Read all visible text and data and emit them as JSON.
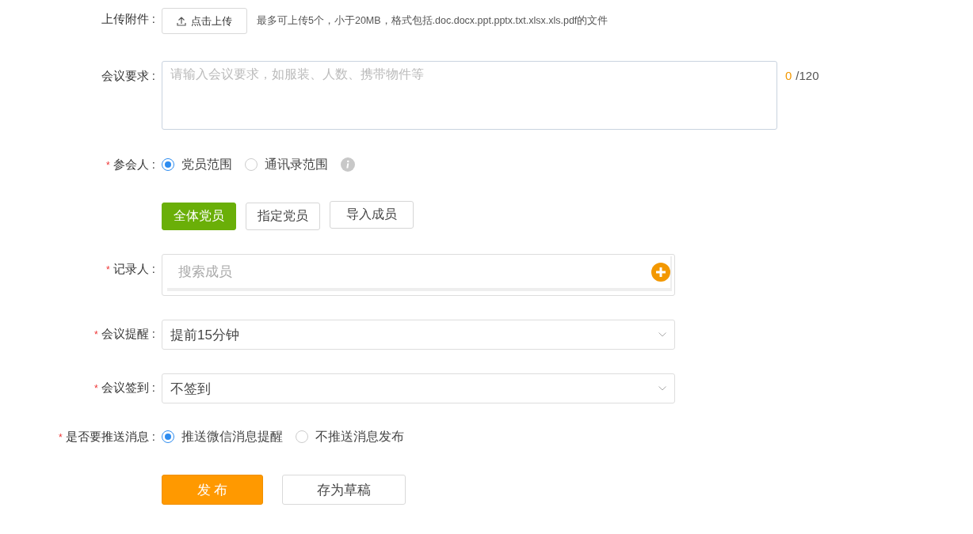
{
  "fields": [
    {
      "kind": "upload",
      "label": "上传附件 :",
      "button": "点击上传",
      "hint": "最多可上传5个，小于20MB，格式包括.doc.docx.ppt.pptx.txt.xlsx.xls.pdf的文件"
    },
    {
      "kind": "textarea",
      "label": "会议要求 :",
      "placeholder": "请输入会议要求，如服装、人数、携带物件等",
      "count": "0",
      "limit": "/120"
    },
    {
      "kind": "radio",
      "label": "参会人 :",
      "marker": "*",
      "info": true,
      "options": [
        {
          "label": "党员范围",
          "selected": true
        },
        {
          "label": "通讯录范围",
          "selected": false
        }
      ]
    },
    {
      "kind": "buttons",
      "options": [
        {
          "label": "全体党员",
          "selected": true
        },
        {
          "label": "指定党员",
          "selected": false
        },
        {
          "label": "导入成员",
          "selected": false
        }
      ]
    },
    {
      "kind": "search",
      "label": "记录人 :",
      "marker": "*",
      "placeholder": "搜索成员"
    },
    {
      "kind": "select",
      "label": "会议提醒 :",
      "marker": "*",
      "value": "提前15分钟"
    },
    {
      "kind": "select",
      "label": "会议签到 :",
      "marker": "*",
      "value": "不签到"
    },
    {
      "kind": "radio",
      "label": "是否要推送消息 :",
      "marker": "*",
      "info": false,
      "options": [
        {
          "label": "推送微信消息提醒",
          "selected": true
        },
        {
          "label": "不推送消息发布",
          "selected": false
        }
      ]
    }
  ],
  "actions": [
    {
      "label": "发 布",
      "primary": true
    },
    {
      "label": "存为草稿",
      "primary": false
    }
  ]
}
